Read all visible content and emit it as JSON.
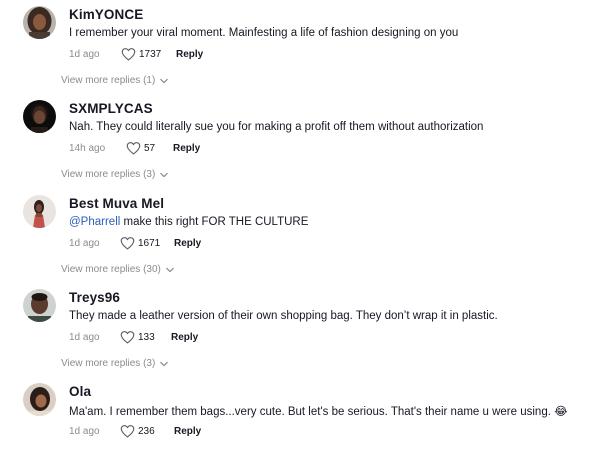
{
  "comments": [
    {
      "username": "KimYONCE",
      "mention": "",
      "text": "I remember your viral moment. Mainfesting a life of fashion designing on you",
      "time": "1d ago",
      "likes": "1737",
      "reply": "Reply",
      "view_more": "View more replies (1)"
    },
    {
      "username": "SXMPLYCAS",
      "mention": "",
      "text": "Nah. They could literally sue you for making a profit off them without authorization",
      "time": "14h ago",
      "likes": "57",
      "reply": "Reply",
      "view_more": "View more replies (3)"
    },
    {
      "username": "Best Muva Mel",
      "mention": "@Pharrell",
      "text": " make this right FOR THE CULTURE",
      "time": "1d ago",
      "likes": "1671",
      "reply": "Reply",
      "view_more": "View more replies (30)"
    },
    {
      "username": "Treys96",
      "mention": "",
      "text": "They made a leather version of their own shopping bag. They don’t wrap it in plastic.",
      "time": "1d ago",
      "likes": "133",
      "reply": "Reply",
      "view_more": "View more replies (3)"
    },
    {
      "username": "Ola",
      "mention": "",
      "text": "Ma'am. I remember them bags...very cute. But let's be serious. That's their name u were using. 😂",
      "time": "1d ago",
      "likes": "236",
      "reply": "Reply",
      "view_more": ""
    }
  ],
  "icons": {
    "like": "heart-outline-icon",
    "expand": "chevron-down-icon"
  },
  "colors": {
    "mention": "#2b5db9",
    "muted": "#8a8b91",
    "text": "#161823"
  }
}
